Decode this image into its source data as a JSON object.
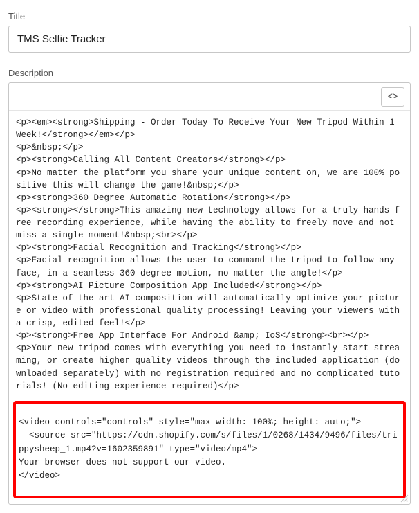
{
  "title_label": "Title",
  "title_value": "TMS Selfie Tracker",
  "description_label": "Description",
  "toolbar": {
    "code_view_label": "<>"
  },
  "code_lines": [
    "<p><em><strong>Shipping - Order Today To Receive Your New Tripod Within 1 Week!</strong></em></p>",
    "<p>&nbsp;</p>",
    "<p><strong>Calling All Content Creators</strong></p>",
    "<p>No matter the platform you share your unique content on, we are 100% positive this will change the game!&nbsp;</p>",
    "<p><strong>360 Degree Automatic Rotation</strong></p>",
    "<p><strong></strong>This amazing new technology allows for a truly hands-free recording experience, while having the ability to freely move and not miss a single moment!&nbsp;<br></p>",
    "<p><strong>Facial Recognition and Tracking</strong></p>",
    "<p>Facial recognition allows the user to command the tripod to follow any face, in a seamless 360 degree motion, no matter the angle!</p>",
    "<p><strong>AI Picture Composition App Included</strong></p>",
    "<p>State of the art AI composition will automatically optimize your picture or video with professional quality processing! Leaving your viewers with a crisp, edited feel!</p>",
    "<p><strong>Free App Interface For Android &amp; IoS</strong><br></p>",
    "<p>Your new tripod comes with everything you need to instantly start streaming, or create higher quality videos through the included application (downloaded separately) with no registration required and no complicated tutorials! (No editing experience required)</p>"
  ],
  "highlight_lines": [
    "<video controls=\"controls\" style=\"max-width: 100%; height: auto;\">",
    "  <source src=\"https://cdn.shopify.com/s/files/1/0268/1434/9496/files/trippysheep_1.mp4?v=1602359891\" type=\"video/mp4\">",
    "Your browser does not support our video.",
    "</video>"
  ]
}
